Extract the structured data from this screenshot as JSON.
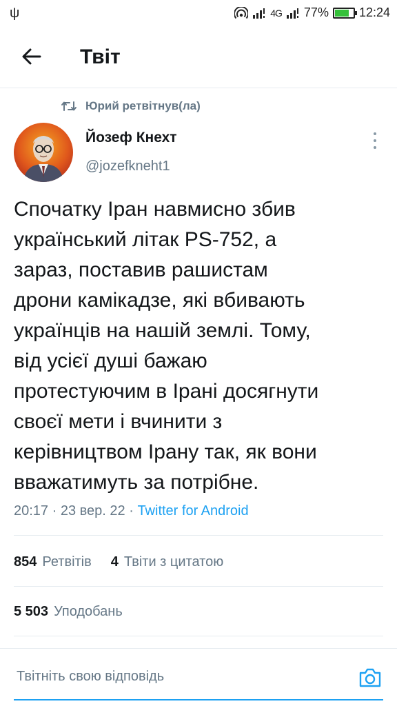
{
  "status_bar": {
    "usb_icon": "usb-icon",
    "network_label": "4G",
    "battery_percent": "77%",
    "battery_level": 0.77,
    "time": "12:24"
  },
  "header": {
    "back_icon": "arrow-left-icon",
    "title": "Твіт"
  },
  "retweet": {
    "icon": "retweet-icon",
    "label": "Юрий ретвітнув(ла)"
  },
  "author": {
    "name": "Йозеф Кнехт",
    "handle": "@jozefkneht1"
  },
  "tweet": {
    "text": "Спочатку Іран навмисно збив\nукраїнський літак PS-752, а\nзараз, поставив рашистам\nдрони камікадзе, які вбивають\nукраїнців на нашій землі. Тому,\nвід усієї душі бажаю\nпротестуючим в Ірані досягнути\nсвоєї мети і вчинити з\nкерівництвом Ірану так, як вони\nвважатимуть за потрібне.",
    "time": "20:17",
    "date": "23 вер. 22",
    "separator": " · ",
    "source": "Twitter for Android"
  },
  "stats": {
    "retweets_count": "854",
    "retweets_label": "Ретвітів",
    "quotes_count": "4",
    "quotes_label": "Твіти з цитатою",
    "likes_count": "5 503",
    "likes_label": "Уподобань"
  },
  "reply": {
    "placeholder": "Твітніть свою відповідь",
    "camera_icon": "camera-icon"
  },
  "colors": {
    "accent": "#1da1f2",
    "text_secondary": "#657786",
    "text_primary": "#14171a"
  }
}
